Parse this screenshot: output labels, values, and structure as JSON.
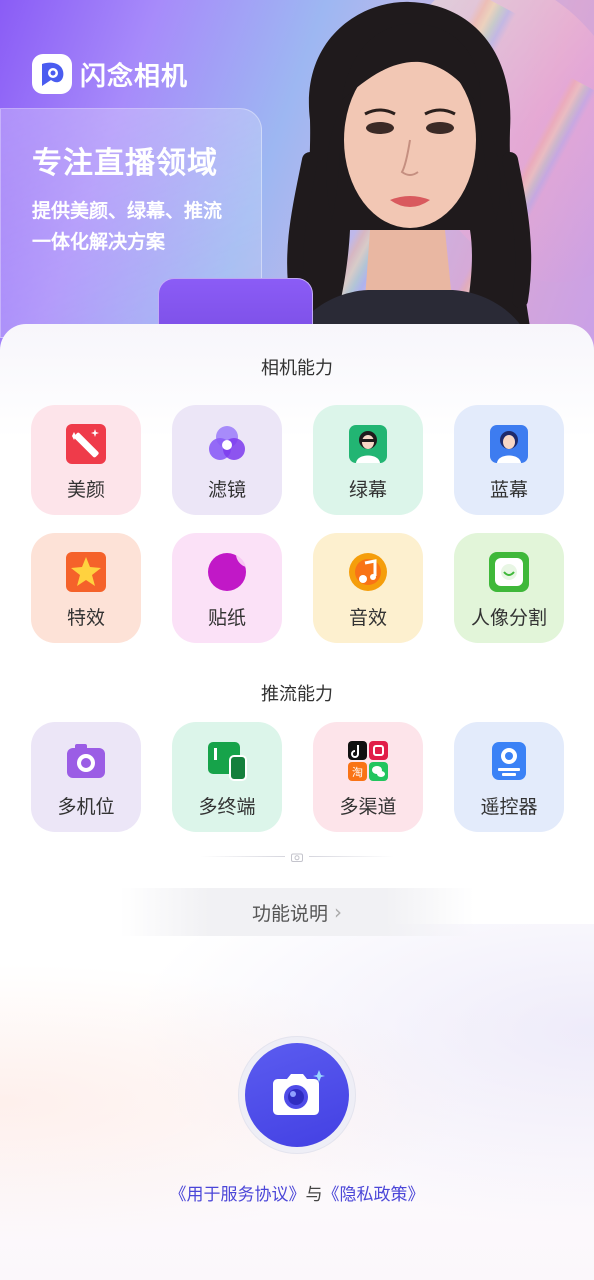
{
  "hero": {
    "app_name": "闪念相机",
    "title": "专注直播领域",
    "subtitle_line1": "提供美颜、绿幕、推流",
    "subtitle_line2": "一体化解决方案"
  },
  "camera_section": {
    "title": "相机能力",
    "items": [
      {
        "label": "美颜",
        "icon": "beauty-wand-icon"
      },
      {
        "label": "滤镜",
        "icon": "filter-circles-icon"
      },
      {
        "label": "绿幕",
        "icon": "green-screen-icon"
      },
      {
        "label": "蓝幕",
        "icon": "blue-screen-icon"
      },
      {
        "label": "特效",
        "icon": "star-effect-icon"
      },
      {
        "label": "贴纸",
        "icon": "sticker-moon-icon"
      },
      {
        "label": "音效",
        "icon": "music-note-icon"
      },
      {
        "label": "人像分割",
        "icon": "portrait-segment-icon"
      }
    ]
  },
  "streaming_section": {
    "title": "推流能力",
    "items": [
      {
        "label": "多机位",
        "icon": "camera-icon"
      },
      {
        "label": "多终端",
        "icon": "devices-icon"
      },
      {
        "label": "多渠道",
        "icon": "channels-icon"
      },
      {
        "label": "遥控器",
        "icon": "remote-icon"
      }
    ]
  },
  "function_link": "功能说明",
  "agreement": {
    "service": "《用于服务协议》",
    "and": "与",
    "privacy": "《隐私政策》"
  },
  "colors": {
    "accent": "#4b46d8",
    "shutter": "#4f4ce8"
  }
}
